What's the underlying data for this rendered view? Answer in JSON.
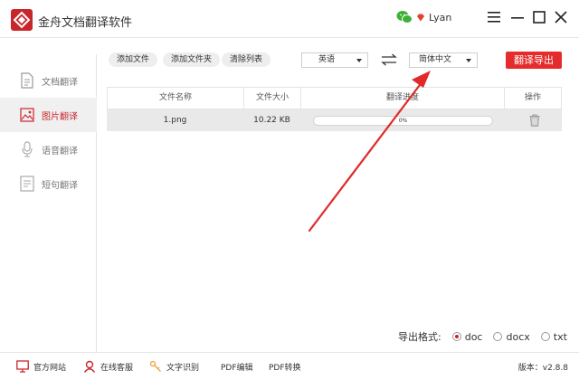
{
  "app": {
    "title": "金舟文档翻译软件",
    "brand_color": "#c9262c"
  },
  "user": {
    "name": "Lyan",
    "wechat_icon": "wechat-icon",
    "vip_icon": "vip-diamond-icon"
  },
  "window_controls": [
    "menu-icon",
    "minimize-icon",
    "maximize-icon",
    "close-icon"
  ],
  "sidebar": {
    "items": [
      {
        "label": "文档翻译",
        "icon": "document-icon",
        "active": false
      },
      {
        "label": "图片翻译",
        "icon": "image-icon",
        "active": true
      },
      {
        "label": "语音翻译",
        "icon": "microphone-icon",
        "active": false
      },
      {
        "label": "短句翻译",
        "icon": "text-icon",
        "active": false
      }
    ]
  },
  "toolbar": {
    "add_file": "添加文件",
    "add_folder": "添加文件夹",
    "clear_list": "清除列表",
    "source_lang": "英语",
    "target_lang": "简体中文",
    "translate_export": "翻译导出",
    "accent_color": "#e52b2b"
  },
  "table": {
    "headers": {
      "name": "文件名称",
      "size": "文件大小",
      "progress": "翻译进度",
      "action": "操作"
    },
    "rows": [
      {
        "name": "1.png",
        "size": "10.22 KB",
        "progress_text": "0%",
        "progress_value": 0,
        "action_icon": "trash-icon"
      }
    ]
  },
  "export_format": {
    "label": "导出格式:",
    "options": [
      {
        "label": "doc",
        "selected": true
      },
      {
        "label": "docx",
        "selected": false
      },
      {
        "label": "txt",
        "selected": false
      }
    ]
  },
  "footer": {
    "links": [
      {
        "label": "官方网站",
        "icon": "monitor-icon"
      },
      {
        "label": "在线客服",
        "icon": "support-icon"
      },
      {
        "label": "文字识别",
        "icon": "ocr-icon"
      },
      {
        "label": "PDF编辑",
        "icon": ""
      },
      {
        "label": "PDF转换",
        "icon": ""
      }
    ],
    "version": "版本：v2.8.8"
  }
}
